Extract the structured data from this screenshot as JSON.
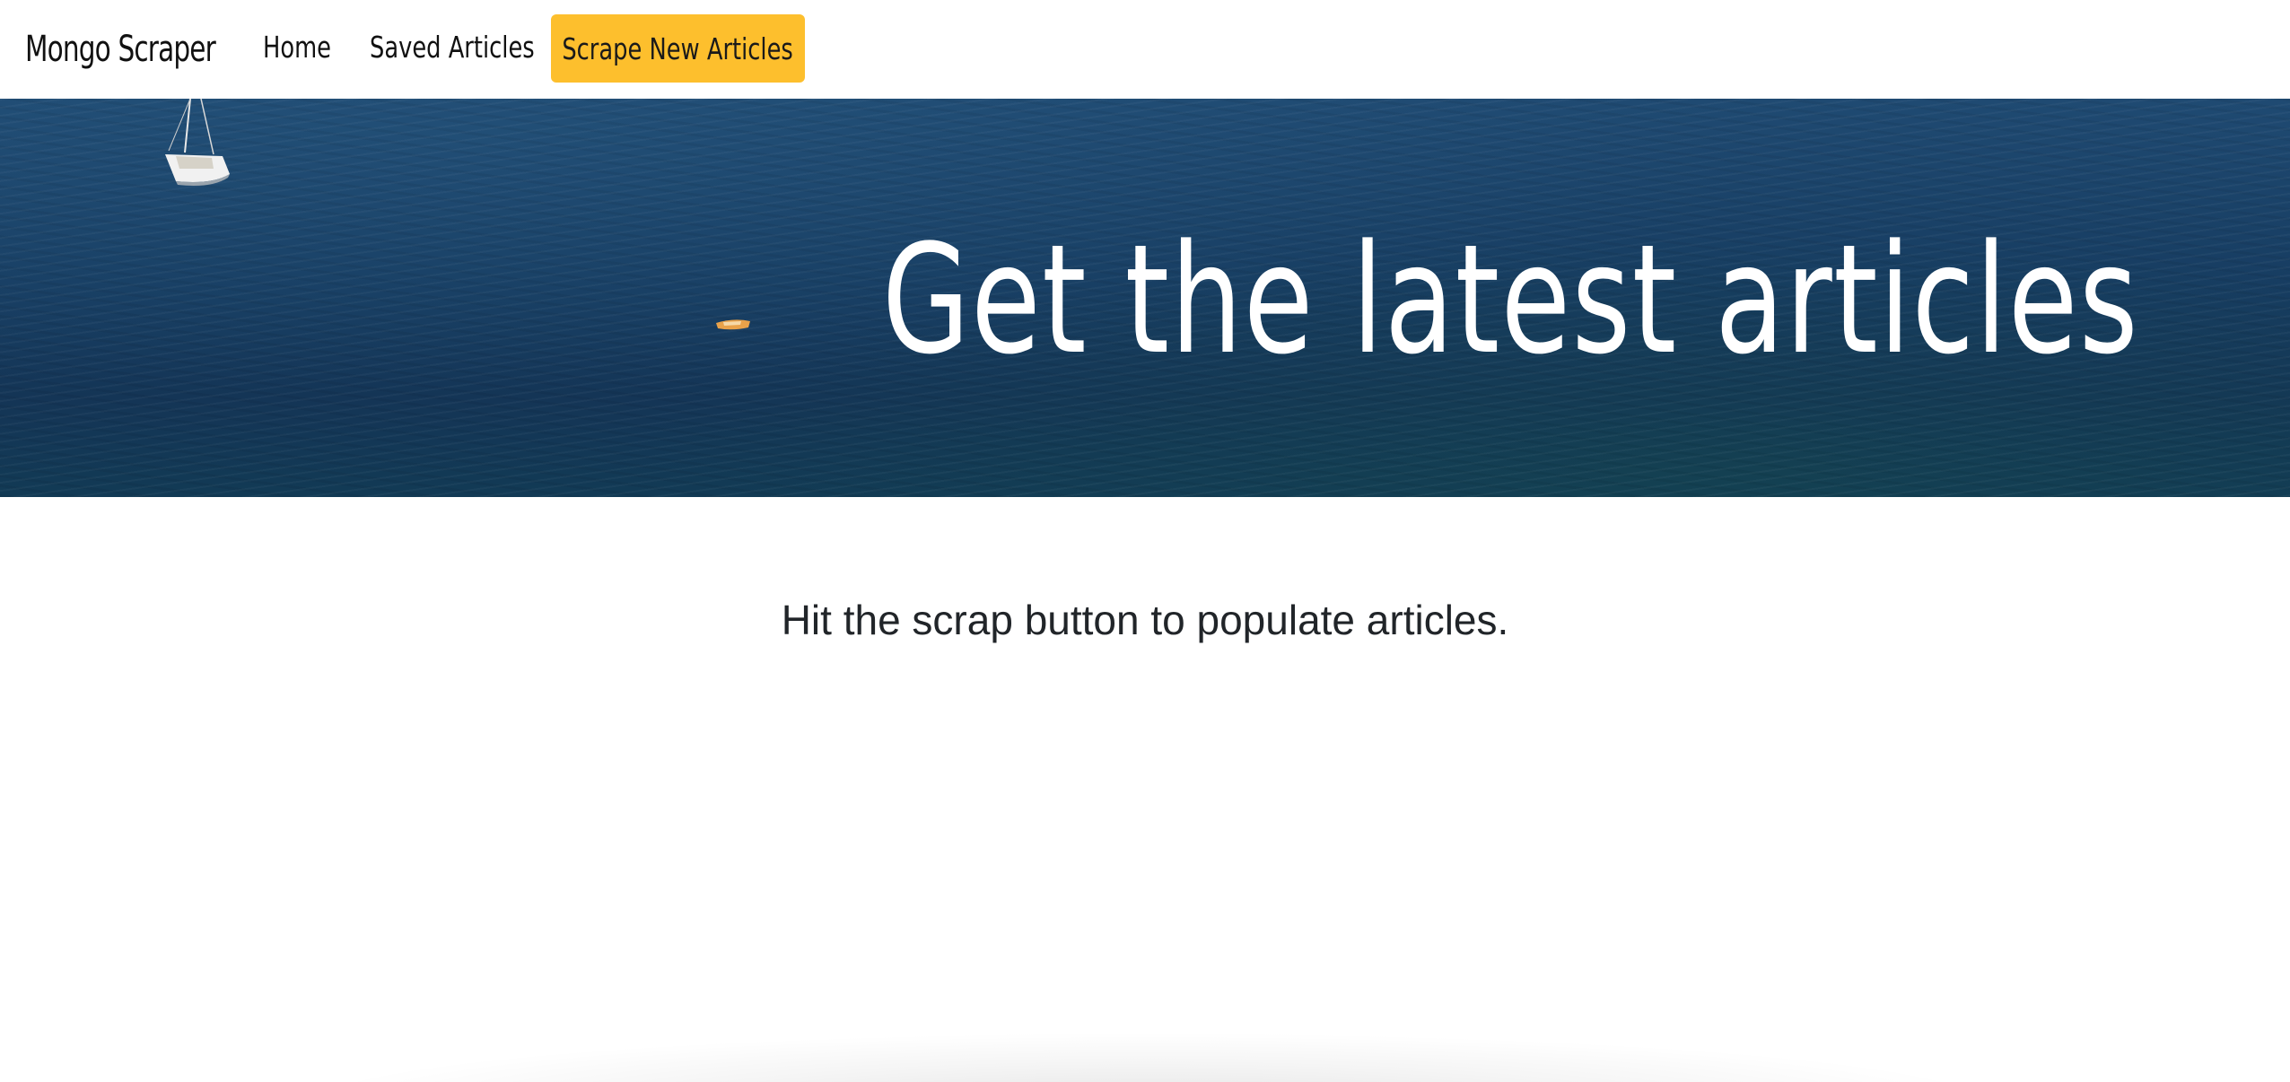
{
  "navbar": {
    "brand": "Mongo Scraper",
    "links": [
      {
        "label": "Home"
      },
      {
        "label": "Saved Articles"
      }
    ],
    "scrape_button_label": "Scrape New Articles"
  },
  "hero": {
    "title": "Get the latest articles"
  },
  "main": {
    "message": "Hit the scrap button to populate articles."
  },
  "colors": {
    "accent": "#fdbf2d",
    "hero_ocean": "#173d62",
    "text": "#212529"
  }
}
